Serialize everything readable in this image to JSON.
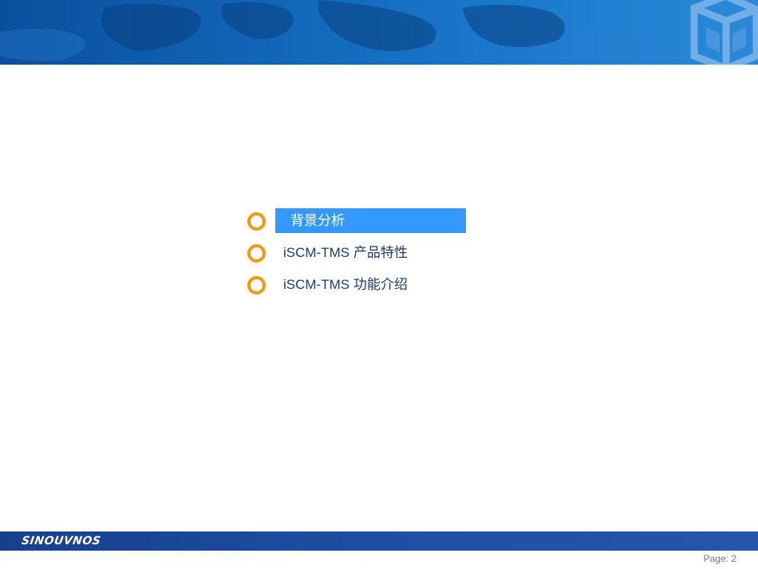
{
  "header": {
    "accent_color": "#1165b8"
  },
  "agenda": {
    "items": [
      {
        "label": "背景分析",
        "active": true
      },
      {
        "label": "iSCM-TMS 产品特性",
        "active": false
      },
      {
        "label": "iSCM-TMS 功能介绍",
        "active": false
      }
    ],
    "bullet_color": "#f39a0c",
    "highlight_color": "#3399ff"
  },
  "footer": {
    "brand": "SINOUVNOS",
    "page_label": "Page: 2"
  }
}
